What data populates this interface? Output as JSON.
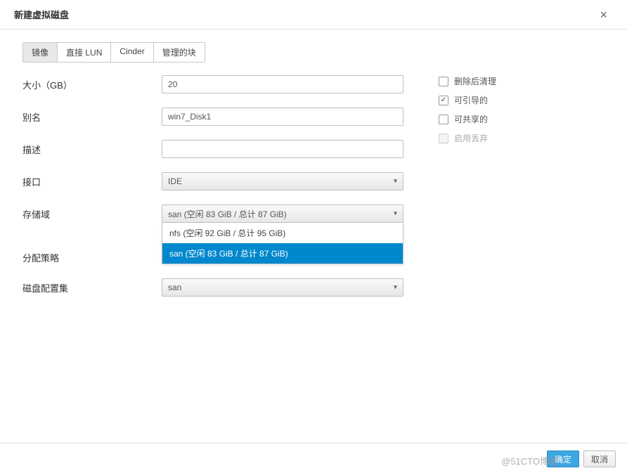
{
  "dialog": {
    "title": "新建虚拟磁盘"
  },
  "tabs": [
    {
      "label": "镜像",
      "active": true
    },
    {
      "label": "直接 LUN",
      "active": false
    },
    {
      "label": "Cinder",
      "active": false
    },
    {
      "label": "管理的块",
      "active": false
    }
  ],
  "fields": {
    "size": {
      "label": "大小（GB）",
      "value": "20"
    },
    "alias": {
      "label": "别名",
      "value": "win7_Disk1"
    },
    "description": {
      "label": "描述",
      "value": ""
    },
    "interface": {
      "label": "接口",
      "value": "IDE"
    },
    "storage_domain": {
      "label": "存储域",
      "value": "san (空闲 83 GiB / 总计 87 GiB)",
      "options": [
        {
          "label": "nfs (空闲 92 GiB / 总计 95 GiB)",
          "selected": false
        },
        {
          "label": "san (空闲 83 GiB / 总计 87 GiB)",
          "selected": true
        }
      ]
    },
    "allocation_policy": {
      "label": "分配策略",
      "value": ""
    },
    "disk_profile": {
      "label": "磁盘配置集",
      "value": "san"
    }
  },
  "checkboxes": {
    "wipe_after_delete": {
      "label": "删除后清理",
      "checked": false,
      "disabled": false
    },
    "bootable": {
      "label": "可引导的",
      "checked": true,
      "disabled": false
    },
    "shareable": {
      "label": "可共享的",
      "checked": false,
      "disabled": false
    },
    "enable_discard": {
      "label": "启用丢弃",
      "checked": false,
      "disabled": true
    }
  },
  "footer": {
    "ok": "确定",
    "cancel": "取消"
  },
  "watermark": "@51CTO博客"
}
